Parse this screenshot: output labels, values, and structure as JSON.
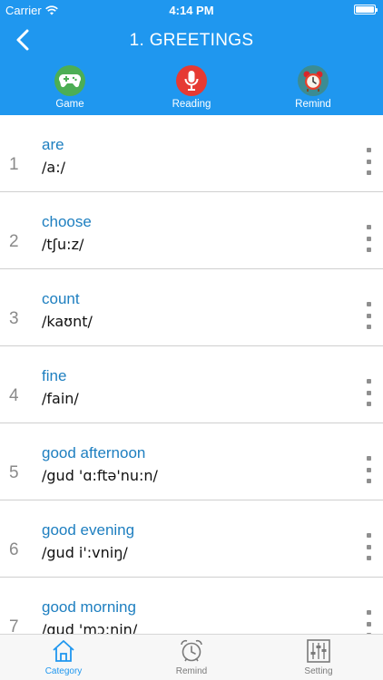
{
  "status_bar": {
    "carrier": "Carrier",
    "time": "4:14 PM"
  },
  "nav": {
    "title": "1. GREETINGS",
    "back_icon": "chevron-left-icon"
  },
  "actions": [
    {
      "label": "Game",
      "icon": "gamepad-icon",
      "color": "#4cae54"
    },
    {
      "label": "Reading",
      "icon": "microphone-icon",
      "color": "#e63a33"
    },
    {
      "label": "Remind",
      "icon": "alarm-clock-icon",
      "color": "#3b8c93"
    }
  ],
  "words": [
    {
      "num": "1",
      "word": "are",
      "ipa": "/a:/"
    },
    {
      "num": "2",
      "word": "choose",
      "ipa": "/tʃu:z/"
    },
    {
      "num": "3",
      "word": "count",
      "ipa": "/kaʊnt/"
    },
    {
      "num": "4",
      "word": "fine",
      "ipa": "/fain/"
    },
    {
      "num": "5",
      "word": "good afternoon",
      "ipa": "/gud 'ɑ:ftə'nu:n/"
    },
    {
      "num": "6",
      "word": "good evening",
      "ipa": "/gud i':vniŋ/"
    },
    {
      "num": "7",
      "word": "good morning",
      "ipa": "/gud 'mɔ:niŋ/"
    }
  ],
  "tabs": [
    {
      "label": "Category",
      "icon": "home-icon",
      "active": true
    },
    {
      "label": "Remind",
      "icon": "alarm-clock-icon",
      "active": false
    },
    {
      "label": "Setting",
      "icon": "sliders-icon",
      "active": false
    }
  ],
  "colors": {
    "header": "#1f97ef",
    "word": "#1e7fc0",
    "active_tab": "#1f97ef"
  }
}
